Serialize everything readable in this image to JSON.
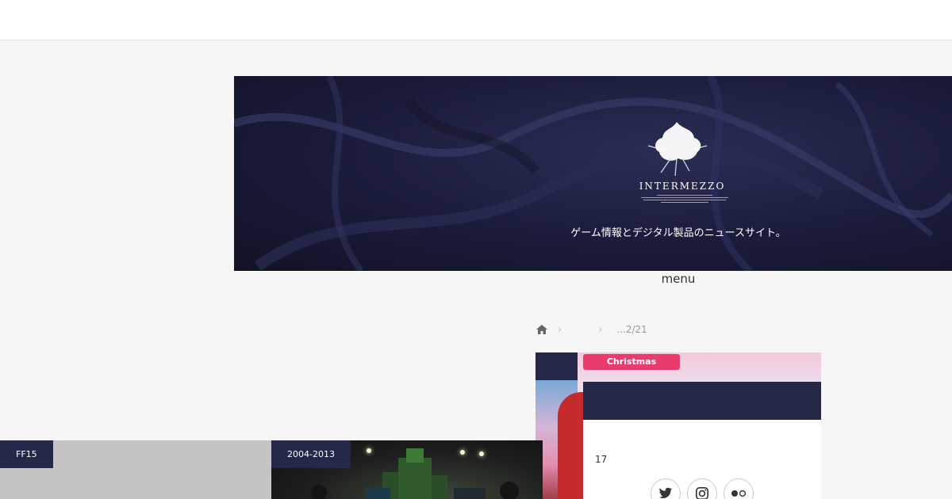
{
  "header": {
    "logo_text": "INTERMEZZO",
    "tagline": "ゲーム情報とデジタル製品のニュースサイト。",
    "menu_label": "menu"
  },
  "breadcrumb": {
    "icon": "home-icon",
    "separator": "›",
    "current": "...2/21"
  },
  "article": {
    "hero_sign": "Christmas"
  },
  "author_card": {
    "count": "17",
    "social": [
      "twitter-icon",
      "instagram-icon",
      "flickr-icon"
    ]
  },
  "posts": [
    {
      "category": "FF15"
    },
    {
      "category": "2004-2013"
    }
  ],
  "colors": {
    "accent": "#26284a",
    "page_bg": "#f6f6f6"
  }
}
